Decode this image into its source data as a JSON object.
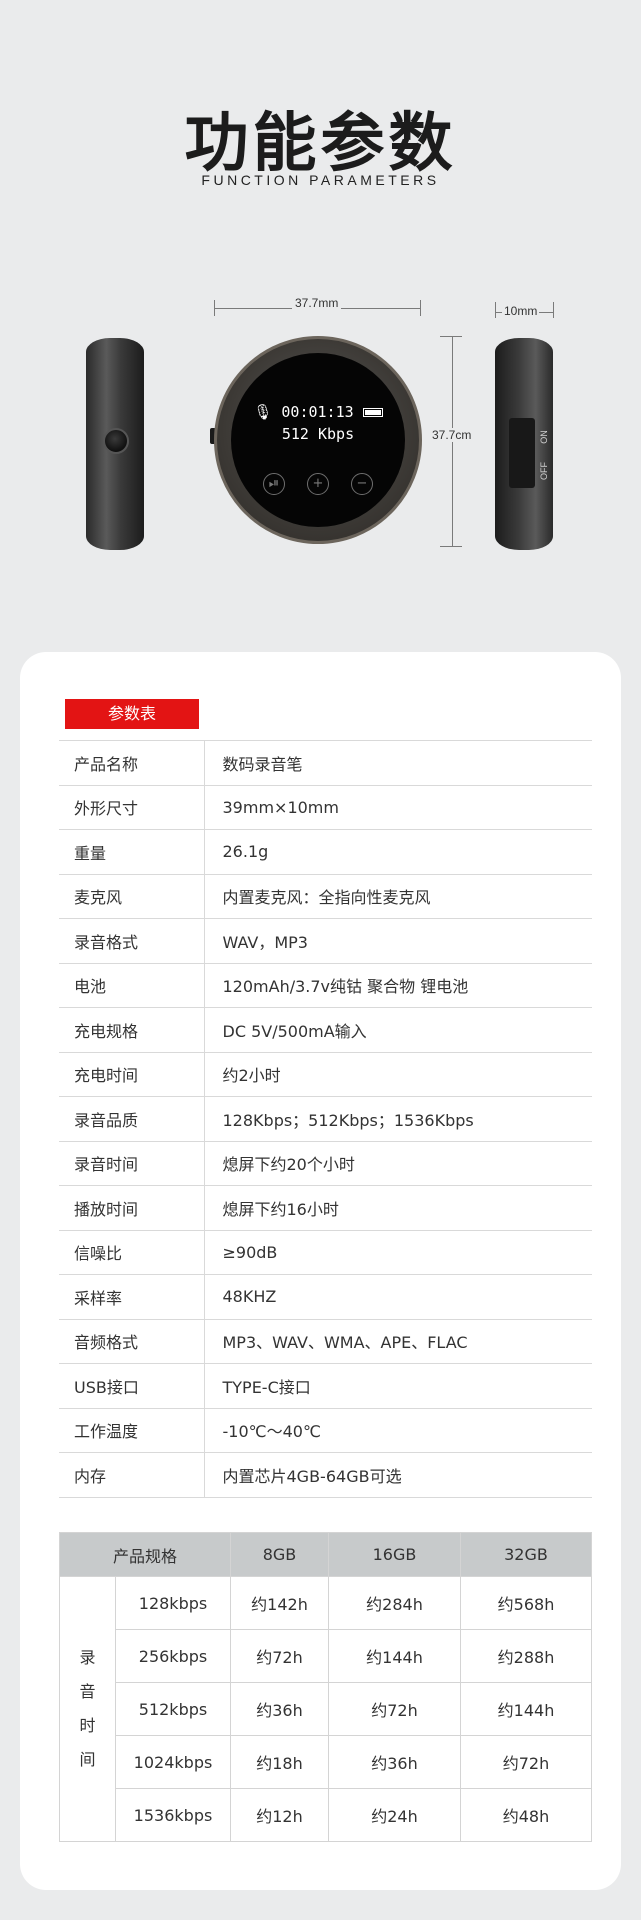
{
  "header": {
    "title": "功能参数",
    "subtitle": "FUNCTION PARAMETERS"
  },
  "device": {
    "width_dim": "37.7mm",
    "thickness_dim": "10mm",
    "height_dim": "37.7cm",
    "screen_time": "00:01:13",
    "screen_rate": "512 Kbps",
    "switch_on": "ON",
    "switch_off": "OFF"
  },
  "params": {
    "badge": "参数表",
    "rows": [
      {
        "key": "产品名称",
        "value": "数码录音笔"
      },
      {
        "key": "外形尺寸",
        "value": "39mm×10mm"
      },
      {
        "key": "重量",
        "value": "26.1g"
      },
      {
        "key": "麦克风",
        "value": "内置麦克风：全指向性麦克风"
      },
      {
        "key": "录音格式",
        "value": "WAV，MP3"
      },
      {
        "key": "电池",
        "value": "120mAh/3.7v纯钴 聚合物 锂电池"
      },
      {
        "key": "充电规格",
        "value": "DC 5V/500mA输入"
      },
      {
        "key": "充电时间",
        "value": "约2小时"
      },
      {
        "key": "录音品质",
        "value": "128Kbps；512Kbps；1536Kbps"
      },
      {
        "key": "录音时间",
        "value": "熄屏下约20个小时"
      },
      {
        "key": "播放时间",
        "value": "熄屏下约16小时"
      },
      {
        "key": "信噪比",
        "value": "≥90dB"
      },
      {
        "key": "采样率",
        "value": "48KHZ"
      },
      {
        "key": "音频格式",
        "value": "MP3、WAV、WMA、APE、FLAC"
      },
      {
        "key": "USB接口",
        "value": "TYPE-C接口"
      },
      {
        "key": "工作温度",
        "value": "-10℃～40℃"
      },
      {
        "key": "内存",
        "value": "内置芯片4GB-64GB可选"
      }
    ]
  },
  "capacity": {
    "headers": [
      "产品规格",
      "8GB",
      "16GB",
      "32GB"
    ],
    "row_label": [
      "录",
      "音",
      "时",
      "间"
    ],
    "rows": [
      {
        "rate": "128kbps",
        "v8": "约142h",
        "v16": "约284h",
        "v32": "约568h"
      },
      {
        "rate": "256kbps",
        "v8": "约72h",
        "v16": "约144h",
        "v32": "约288h"
      },
      {
        "rate": "512kbps",
        "v8": "约36h",
        "v16": "约72h",
        "v32": "约144h"
      },
      {
        "rate": "1024kbps",
        "v8": "约18h",
        "v16": "约36h",
        "v32": "约72h"
      },
      {
        "rate": "1536kbps",
        "v8": "约12h",
        "v16": "约24h",
        "v32": "约48h"
      }
    ]
  }
}
